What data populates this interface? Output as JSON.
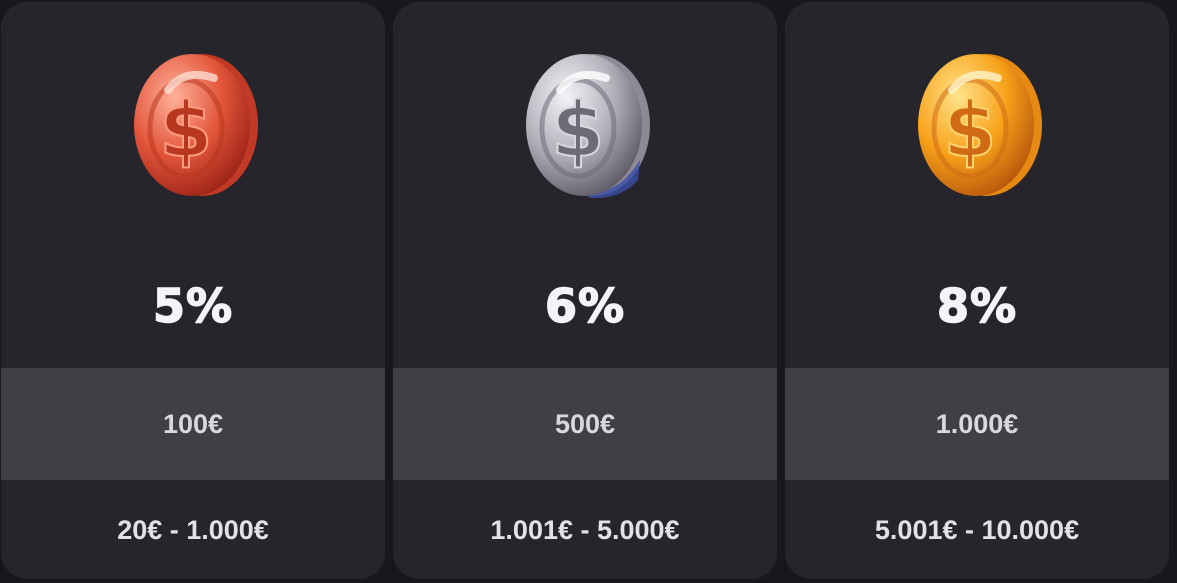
{
  "tiers": [
    {
      "coin_icon": "bronze-dollar-coin-icon",
      "coin_colors": {
        "light": "#ffb09a",
        "base": "#e2553a",
        "dark": "#9e2418",
        "edge": "#c23a26",
        "symbol": "#b8381f"
      },
      "percent": "5%",
      "amount": "100€",
      "range": "20€ - 1.000€"
    },
    {
      "coin_icon": "silver-dollar-coin-icon",
      "coin_colors": {
        "light": "#f4f2f8",
        "base": "#b3afb9",
        "dark": "#5f5b67",
        "edge": "#8d8996",
        "symbol": "#6e6a76"
      },
      "percent": "6%",
      "amount": "500€",
      "range": "1.001€ - 5.000€"
    },
    {
      "coin_icon": "gold-dollar-coin-icon",
      "coin_colors": {
        "light": "#ffe38a",
        "base": "#f7a21a",
        "dark": "#b9580c",
        "edge": "#e68a13",
        "symbol": "#d06a14"
      },
      "percent": "8%",
      "amount": "1.000€",
      "range": "5.001€ - 10.000€"
    }
  ]
}
